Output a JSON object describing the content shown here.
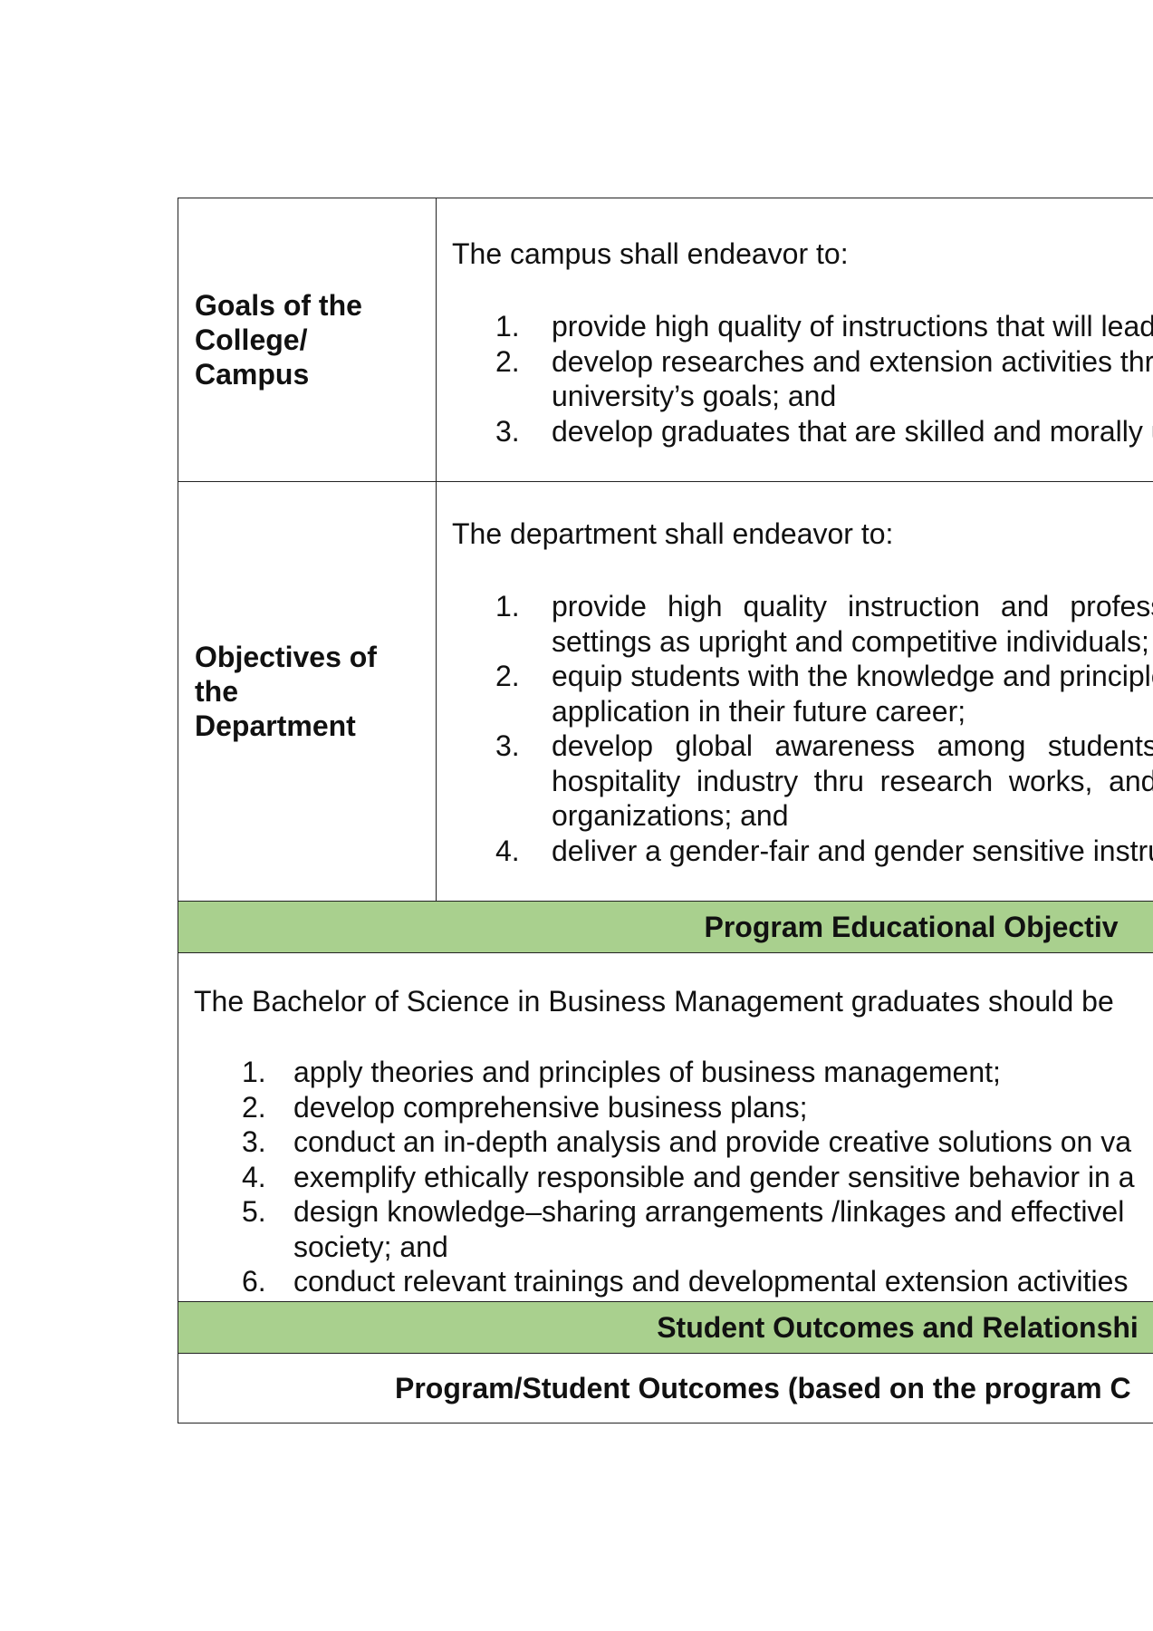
{
  "goals": {
    "label": "Goals of the College/ Campus",
    "label_lines": [
      "Goals of the",
      "College/",
      "Campus"
    ],
    "intro": "The campus shall endeavor to:",
    "items": [
      {
        "num": "1.",
        "lines": [
          "provide high quality of instructions that will lead"
        ]
      },
      {
        "num": "2.",
        "lines": [
          "develop researches and extension activities thr",
          "university’s goals; and"
        ]
      },
      {
        "num": "3.",
        "lines": [
          "develop graduates that are skilled and morally u"
        ]
      }
    ]
  },
  "objectives": {
    "label_lines": [
      "Objectives of",
      "the",
      "Department"
    ],
    "intro": "The department shall endeavor to:",
    "items": [
      {
        "num": "1.",
        "lines": [
          "provide high quality instruction and profession",
          "settings as upright and competitive individuals;"
        ]
      },
      {
        "num": "2.",
        "lines": [
          "equip students with the knowledge and principle",
          "application in their future career;"
        ]
      },
      {
        "num": "3.",
        "lines": [
          "develop global awareness among students to",
          "hospitality industry thru research works, and co",
          "organizations; and"
        ]
      },
      {
        "num": "4.",
        "lines": [
          "deliver a gender-fair and gender sensitive instru"
        ]
      }
    ]
  },
  "peo_header": "Program Educational Objectiv",
  "peo": {
    "intro": "The Bachelor of Science in Business Management graduates should be",
    "items": [
      {
        "num": "1.",
        "lines": [
          "apply theories and principles of business management;"
        ]
      },
      {
        "num": "2.",
        "lines": [
          "develop comprehensive business plans;"
        ]
      },
      {
        "num": "3.",
        "lines": [
          "conduct an in-depth analysis and provide creative solutions on va"
        ]
      },
      {
        "num": "4.",
        "lines": [
          "exemplify ethically responsible and gender sensitive behavior in a"
        ]
      },
      {
        "num": "5.",
        "lines": [
          "design knowledge–sharing arrangements /linkages and effectivel",
          "society; and"
        ]
      },
      {
        "num": "6.",
        "lines": [
          "conduct relevant trainings and developmental extension activities"
        ]
      }
    ]
  },
  "so_header": "Student Outcomes and Relationshi",
  "outcomes_header": "Program/Student Outcomes (based on the program C"
}
